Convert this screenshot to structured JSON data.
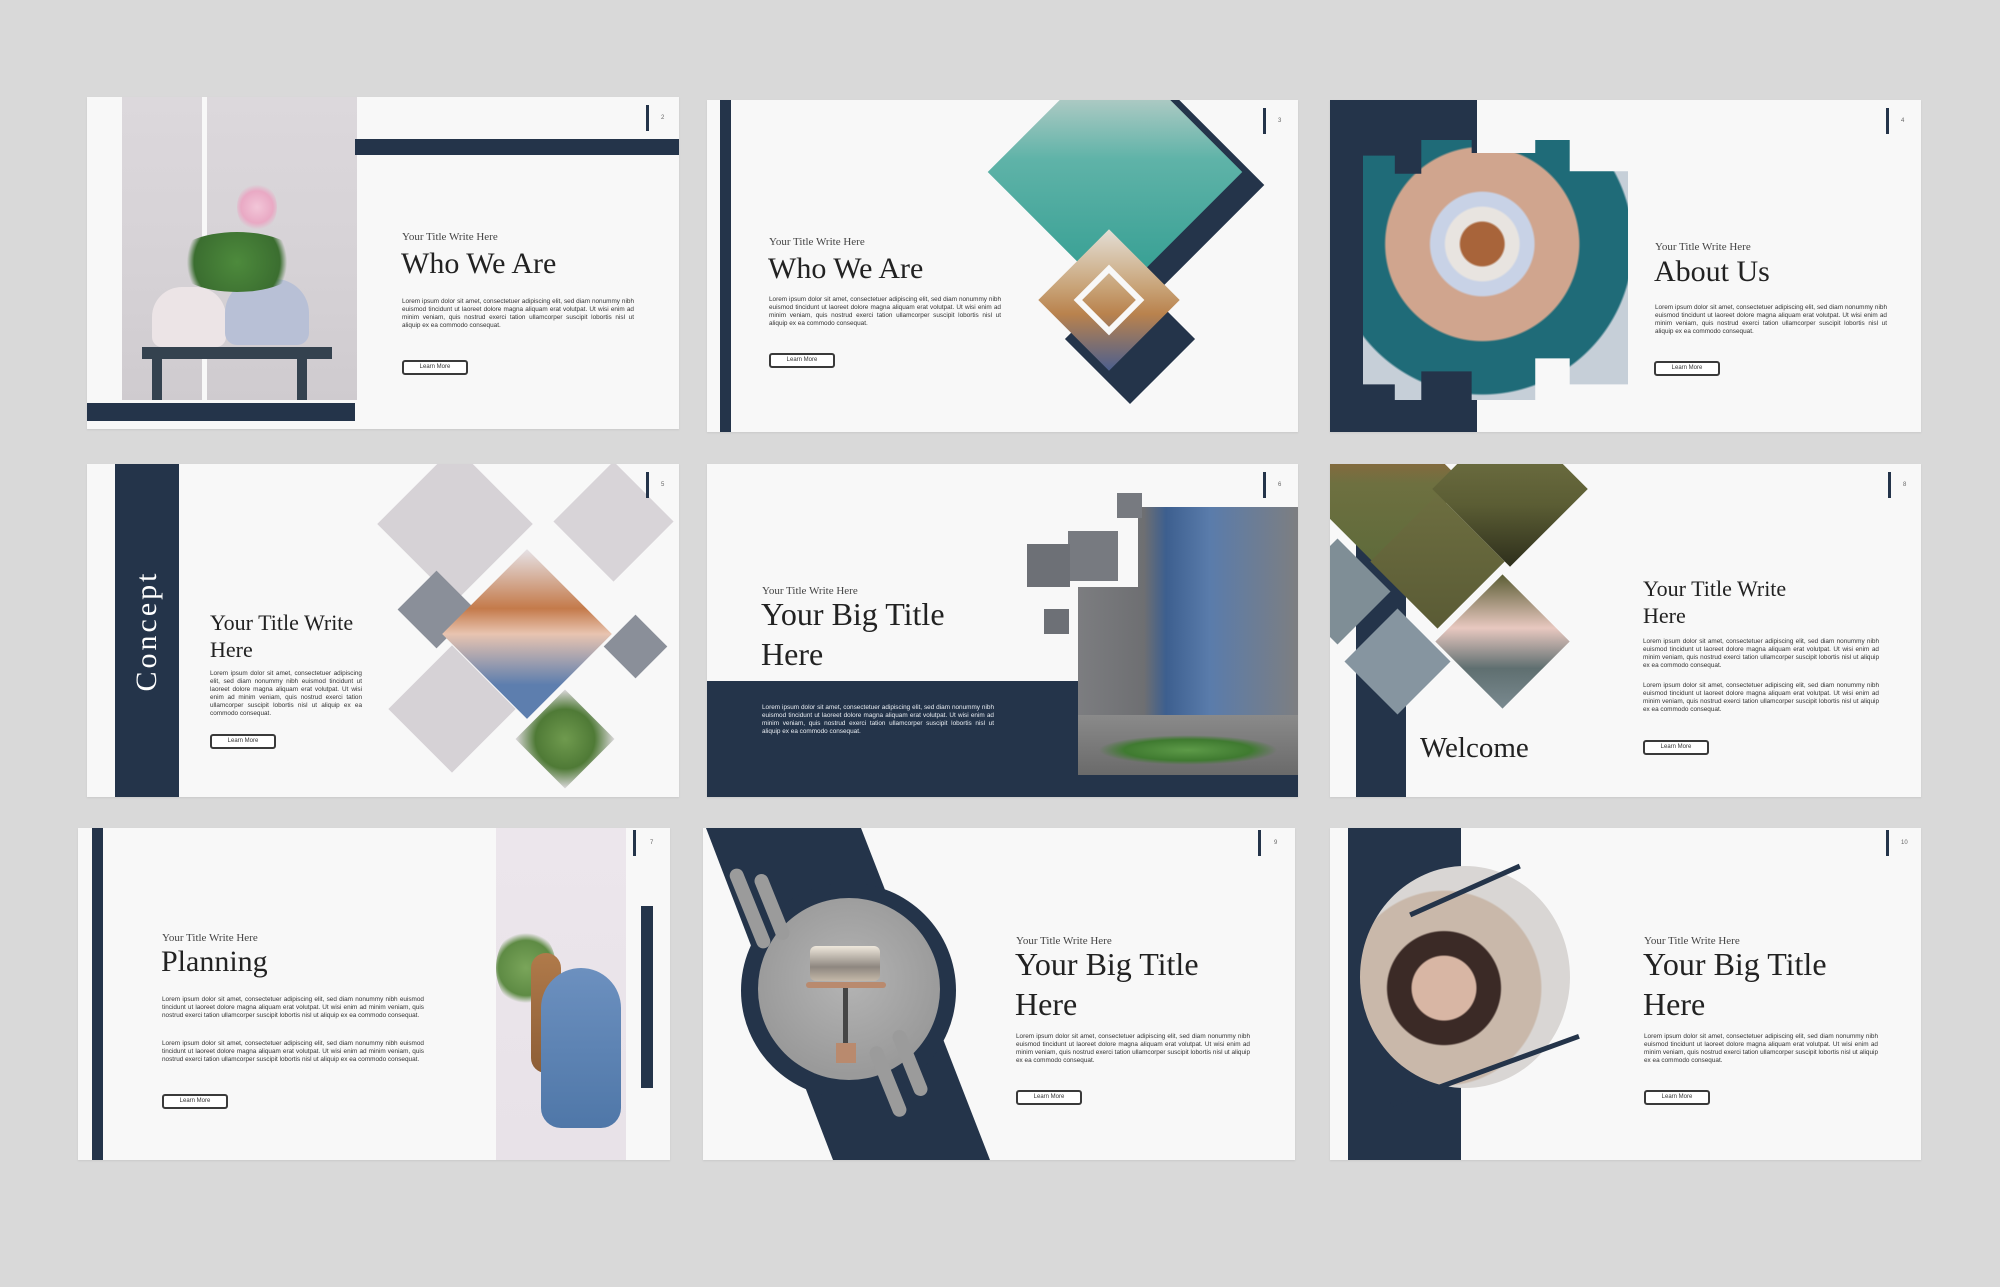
{
  "colors": {
    "navy": "#24344a",
    "background": "#d9d9d9",
    "slide": "#f8f8f8"
  },
  "slides": [
    {
      "page": "2",
      "kicker": "Your Title Write Here",
      "title": "Who We Are",
      "body": "Lorem ipsum dolor sit amet, consectetuer adipiscing elit, sed diam nonummy nibh euismod tincidunt ut laoreet dolore magna aliquam erat volutpat. Ut wisi enim ad minim veniam, quis nostrud exerci tation ullamcorper suscipit lobortis nisl ut aliquip ex ea commodo consequat.",
      "button": "Learn More",
      "image": "potted-flowers-photo"
    },
    {
      "page": "3",
      "kicker": "Your Title Write Here",
      "title": "Who We Are",
      "body": "Lorem ipsum dolor sit amet, consectetuer adipiscing elit, sed diam nonummy nibh euismod tincidunt ut laoreet dolore magna aliquam erat volutpat. Ut wisi enim ad minim veniam, quis nostrud exerci tation ullamcorper suscipit lobortis nisl ut aliquip ex ea commodo consequat.",
      "button": "Learn More",
      "image": "teal-coat-photo"
    },
    {
      "page": "4",
      "kicker": "Your Title Write Here",
      "title": "About Us",
      "body": "Lorem ipsum dolor sit amet, consectetuer adipiscing elit, sed diam nonummy nibh euismod tincidunt ut laoreet dolore magna aliquam erat volutpat. Ut wisi enim ad minim veniam, quis nostrud exerci tation ullamcorper suscipit lobortis nisl ut aliquip ex ea commodo consequat.",
      "button": "Learn More",
      "image": "coffee-cup-photo"
    },
    {
      "page": "5",
      "side_label": "Concept",
      "title_line1": "Your Title Write",
      "title_line2": "Here",
      "body": "Lorem ipsum dolor sit amet, consectetuer adipiscing elit, sed diam nonummy nibh euismod tincidunt ut laoreet dolore magna aliquam erat volutpat. Ut wisi enim ad minim veniam, quis nostrud exerci tation ullamcorper suscipit lobortis nisl ut aliquip ex ea commodo consequat.",
      "button": "Learn More",
      "image": "woman-sweater-photo"
    },
    {
      "page": "6",
      "kicker": "Your Title Write Here",
      "title_line1": "Your Big Title",
      "title_line2": "Here",
      "body": "Lorem ipsum dolor sit amet, consectetuer adipiscing elit, sed diam nonummy nibh euismod tincidunt ut laoreet dolore magna aliquam erat volutpat. Ut wisi enim ad minim veniam, quis nostrud exerci tation ullamcorper suscipit lobortis nisl ut aliquip ex ea commodo consequat.",
      "image": "jeans-flowers-photo"
    },
    {
      "page": "8",
      "title_line1": "Your Title Write",
      "title_line2": "Here",
      "side_label": "Welcome",
      "body": "Lorem ipsum dolor sit amet, consectetuer adipiscing elit, sed diam nonummy nibh euismod tincidunt ut laoreet dolore magna aliquam erat volutpat. Ut wisi enim ad minim veniam, quis nostrud exerci tation ullamcorper suscipit lobortis nisl ut aliquip ex ea commodo consequat.",
      "body2": "Lorem ipsum dolor sit amet, consectetuer adipiscing elit, sed diam nonummy nibh euismod tincidunt ut laoreet dolore magna aliquam erat volutpat. Ut wisi enim ad minim veniam, quis nostrud exerci tation ullamcorper suscipit lobortis nisl ut aliquip ex ea commodo consequat.",
      "button": "Learn More",
      "image": "olive-jacket-photo"
    },
    {
      "page": "7",
      "kicker": "Your Title Write Here",
      "title": "Planning",
      "body": "Lorem ipsum dolor sit amet, consectetuer adipiscing elit, sed diam nonummy nibh euismod tincidunt ut laoreet dolore magna aliquam erat volutpat. Ut wisi enim ad minim veniam, quis nostrud exerci tation ullamcorper suscipit lobortis nisl ut aliquip ex ea commodo consequat.",
      "body2": "Lorem ipsum dolor sit amet, consectetuer adipiscing elit, sed diam nonummy nibh euismod tincidunt ut laoreet dolore magna aliquam erat volutpat. Ut wisi enim ad minim veniam, quis nostrud exerci tation ullamcorper suscipit lobortis nisl ut aliquip ex ea commodo consequat.",
      "button": "Learn More",
      "image": "woman-greenery-photo"
    },
    {
      "page": "9",
      "kicker": "Your Title Write Here",
      "title_line1": "Your Big Title",
      "title_line2": "Here",
      "body": "Lorem ipsum dolor sit amet, consectetuer adipiscing elit, sed diam nonummy nibh euismod tincidunt ut laoreet dolore magna aliquam erat volutpat. Ut wisi enim ad minim veniam, quis nostrud exerci tation ullamcorper suscipit lobortis nisl ut aliquip ex ea commodo consequat.",
      "button": "Learn More",
      "image": "folded-sweaters-photo"
    },
    {
      "page": "10",
      "kicker": "Your Title Write Here",
      "title_line1": "Your Big Title",
      "title_line2": "Here",
      "body": "Lorem ipsum dolor sit amet, consectetuer adipiscing elit, sed diam nonummy nibh euismod tincidunt ut laoreet dolore magna aliquam erat volutpat. Ut wisi enim ad minim veniam, quis nostrud exerci tation ullamcorper suscipit lobortis nisl ut aliquip ex ea commodo consequat.",
      "button": "Learn More",
      "image": "woman-hat-photo"
    }
  ]
}
